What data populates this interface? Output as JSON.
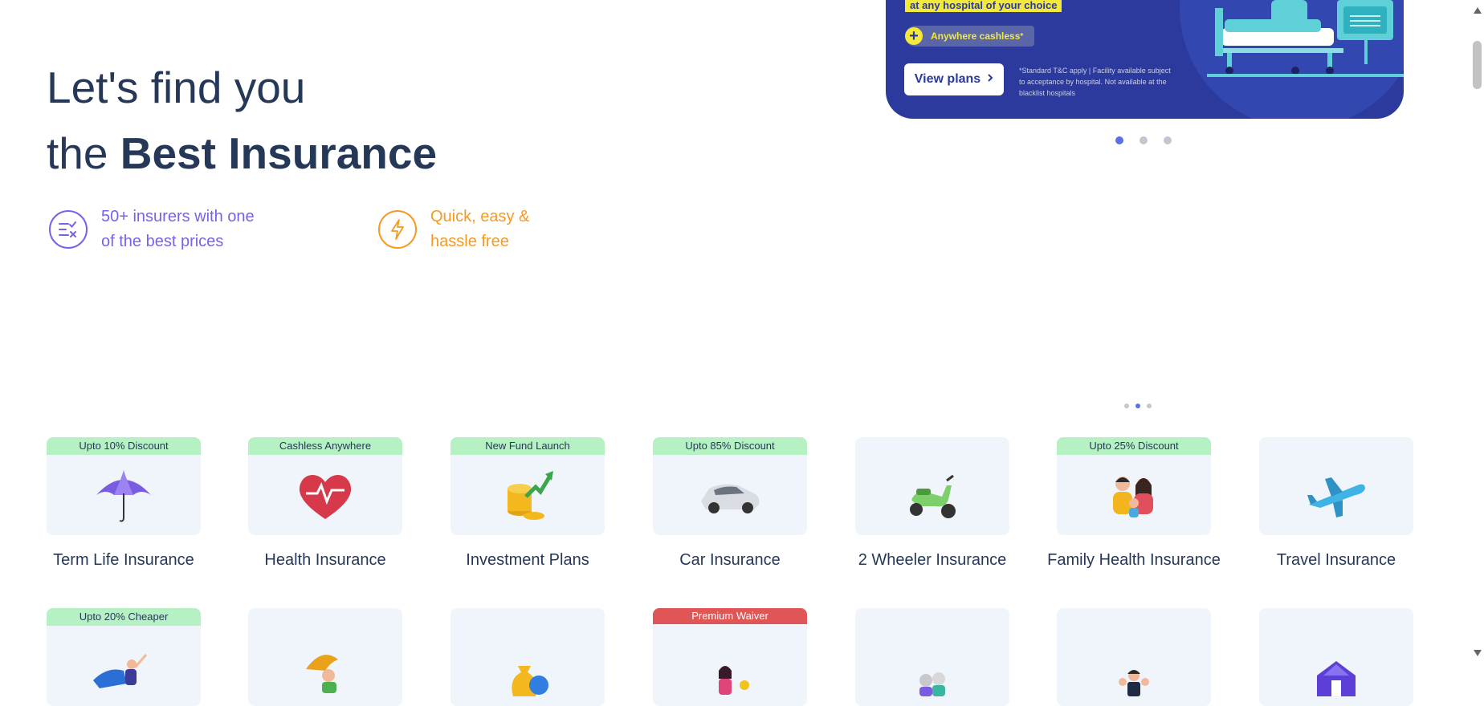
{
  "hero": {
    "line1": "Let's find you",
    "line2_prefix": "the ",
    "line2_bold": "Best Insurance"
  },
  "features": [
    {
      "line1": "50+ insurers with one",
      "line2": "of the best prices",
      "icon": "compare-icon",
      "color": "#7b61e8"
    },
    {
      "line1": "Quick, easy &",
      "line2": "hassle free",
      "icon": "lightning-icon",
      "color": "#f59a23"
    }
  ],
  "banner": {
    "highlight": "at any hospital of your choice",
    "pill": "Anywhere cashless",
    "pill_sup": "*",
    "cta": "View plans",
    "disclaimer": "*Standard T&C apply | Facility available subject to acceptance by hospital. Not available at the blacklist hospitals",
    "colors": {
      "background": "#2b3a9c",
      "highlight": "#f3e93a"
    }
  },
  "carousel": {
    "active_large": 1,
    "total_large": 3,
    "active_small": 2,
    "total_small": 3
  },
  "products_row1": [
    {
      "label": "Term Life Insurance",
      "badge": "Upto 10% Discount",
      "icon": "umbrella-icon"
    },
    {
      "label": "Health Insurance",
      "badge": "Cashless Anywhere",
      "icon": "heart-icon"
    },
    {
      "label": "Investment Plans",
      "badge": "New Fund Launch",
      "icon": "coins-growth-icon"
    },
    {
      "label": "Car Insurance",
      "badge": "Upto 85% Discount",
      "icon": "car-icon"
    },
    {
      "label": "2 Wheeler Insurance",
      "badge": "",
      "icon": "scooter-icon"
    },
    {
      "label": "Family Health Insurance",
      "badge": "Upto 25% Discount",
      "icon": "family-icon"
    },
    {
      "label": "Travel Insurance",
      "badge": "",
      "icon": "airplane-icon"
    }
  ],
  "products_row2": [
    {
      "badge": "Upto 20% Cheaper",
      "badge_style": "green",
      "icon": "superhero-icon"
    },
    {
      "badge": "",
      "badge_style": "",
      "icon": "child-umbrella-icon"
    },
    {
      "badge": "",
      "badge_style": "",
      "icon": "money-bag-icon"
    },
    {
      "badge": "Premium Waiver",
      "badge_style": "red",
      "icon": "woman-coin-icon"
    },
    {
      "badge": "",
      "badge_style": "",
      "icon": "senior-couple-icon"
    },
    {
      "badge": "",
      "badge_style": "",
      "icon": "business-group-icon"
    },
    {
      "badge": "",
      "badge_style": "",
      "icon": "home-icon"
    }
  ]
}
